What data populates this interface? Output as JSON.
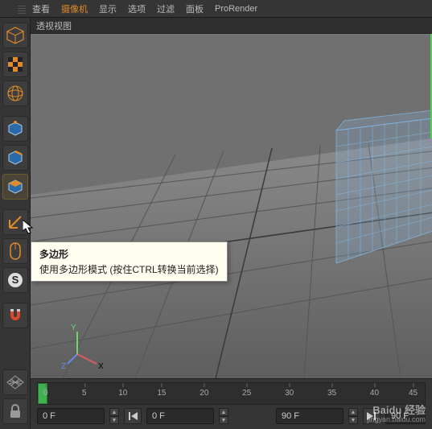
{
  "menu": {
    "items": [
      "查看",
      "摄像机",
      "显示",
      "选项",
      "过滤",
      "面板",
      "ProRender"
    ],
    "active_index": 1
  },
  "viewport": {
    "label": "透视视图",
    "axes": {
      "x": "X",
      "y": "Y",
      "z": "Z"
    }
  },
  "tooltip": {
    "title": "多边形",
    "body": "使用多边形模式 (按住CTRL转换当前选择)"
  },
  "tools": [
    {
      "id": "model-mode",
      "icon": "cube-wire"
    },
    {
      "id": "texture-mode",
      "icon": "checker"
    },
    {
      "id": "uv-mode",
      "icon": "sphere-grid"
    },
    {
      "id": "point-mode",
      "icon": "cube-point"
    },
    {
      "id": "edge-mode",
      "icon": "cube-edge"
    },
    {
      "id": "polygon-mode",
      "icon": "cube-face",
      "selected": true
    },
    {
      "id": "axis-mode",
      "icon": "axis"
    },
    {
      "id": "sculpt-mode",
      "icon": "mouse"
    },
    {
      "id": "snap-toggle",
      "icon": "s-badge"
    },
    {
      "id": "magnet-toggle",
      "icon": "magnet"
    },
    {
      "id": "workplane",
      "icon": "grid-diamond"
    },
    {
      "id": "lock-toggle",
      "icon": "lock"
    }
  ],
  "timeline": {
    "ticks": [
      0,
      5,
      10,
      15,
      20,
      25,
      30,
      35,
      40,
      45
    ],
    "current_frame": "0 F",
    "start_frame": "0 F",
    "end_frame": "90 F",
    "range_end": "90 F"
  },
  "watermark": {
    "brand": "Baidu 经验",
    "url": "jingyan.baidu.com"
  }
}
